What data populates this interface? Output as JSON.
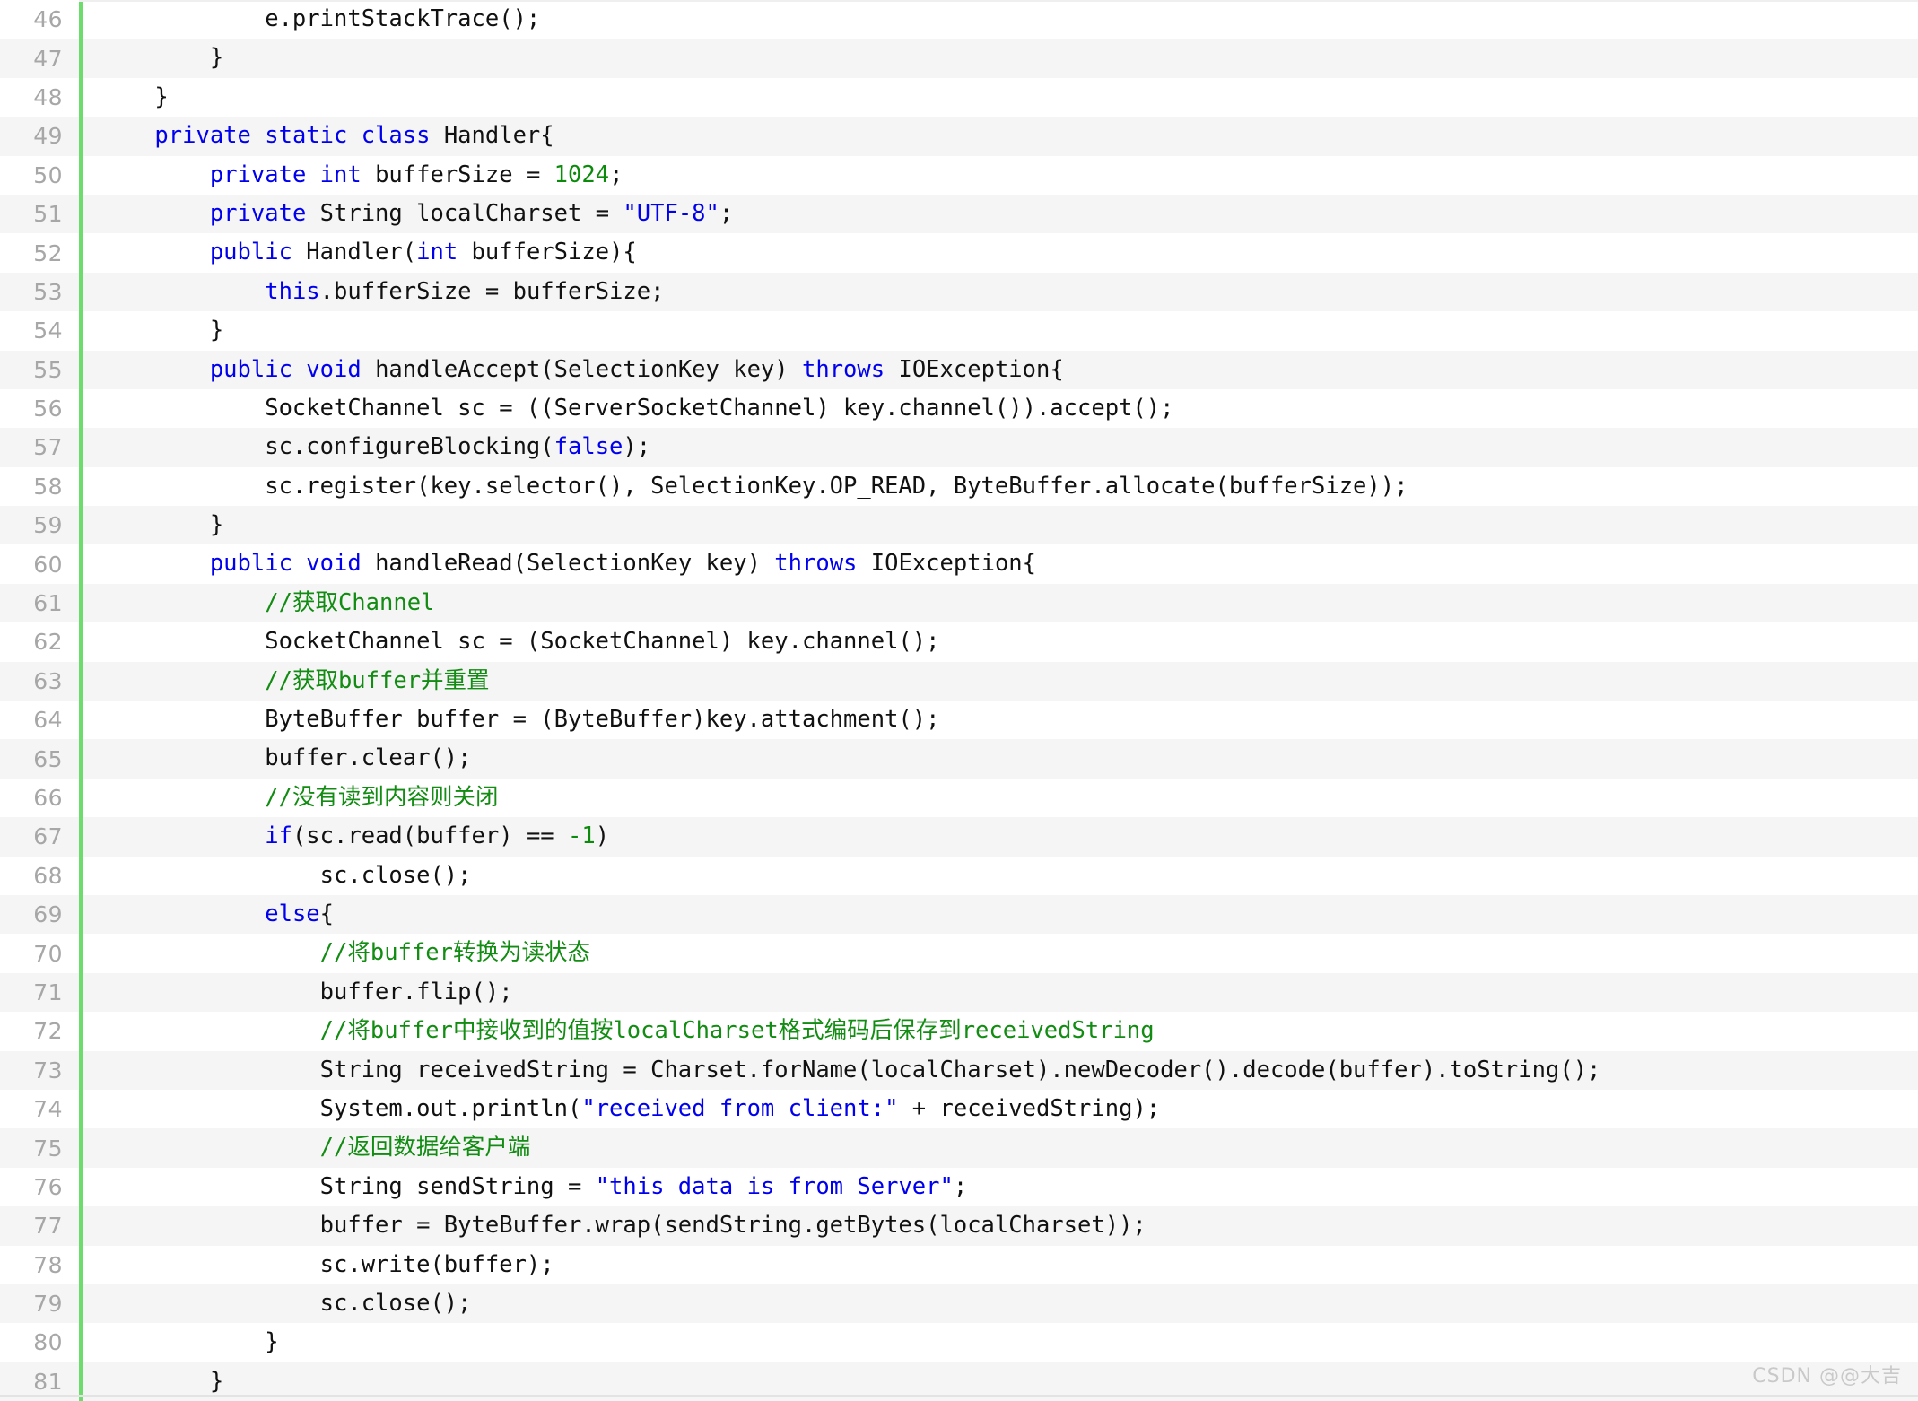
{
  "editor": {
    "language": "java",
    "first_line_number": 46,
    "last_line_number": 81,
    "gutter_accent_color": "#6ddc6d",
    "stripe_color": "#f5f5f5",
    "background_color": "#ffffff",
    "line_number_color": "#a7a7a7",
    "syntax_colors": {
      "keyword": "#0000ee",
      "string": "#0000ee",
      "number": "#0b8a0b",
      "comment": "#128c12",
      "plain": "#111111"
    }
  },
  "watermark": {
    "text": "CSDN @@大吉"
  },
  "lines": [
    {
      "n": "46",
      "text": "            e.printStackTrace();",
      "tokens": [
        {
          "t": "            e.printStackTrace();",
          "c": "plain"
        }
      ]
    },
    {
      "n": "47",
      "text": "        }",
      "tokens": [
        {
          "t": "        }",
          "c": "plain"
        }
      ]
    },
    {
      "n": "48",
      "text": "    }",
      "tokens": [
        {
          "t": "    }",
          "c": "plain"
        }
      ]
    },
    {
      "n": "49",
      "text": "    private static class Handler{",
      "tokens": [
        {
          "t": "    ",
          "c": "plain"
        },
        {
          "t": "private static class",
          "c": "keyword"
        },
        {
          "t": " Handler{",
          "c": "plain"
        }
      ]
    },
    {
      "n": "50",
      "text": "        private int bufferSize = 1024;",
      "tokens": [
        {
          "t": "        ",
          "c": "plain"
        },
        {
          "t": "private int",
          "c": "keyword"
        },
        {
          "t": " bufferSize = ",
          "c": "plain"
        },
        {
          "t": "1024",
          "c": "number"
        },
        {
          "t": ";",
          "c": "plain"
        }
      ]
    },
    {
      "n": "51",
      "text": "        private String localCharset = \"UTF-8\";",
      "tokens": [
        {
          "t": "        ",
          "c": "plain"
        },
        {
          "t": "private",
          "c": "keyword"
        },
        {
          "t": " String localCharset = ",
          "c": "plain"
        },
        {
          "t": "\"UTF-8\"",
          "c": "string"
        },
        {
          "t": ";",
          "c": "plain"
        }
      ]
    },
    {
      "n": "52",
      "text": "        public Handler(int bufferSize){",
      "tokens": [
        {
          "t": "        ",
          "c": "plain"
        },
        {
          "t": "public",
          "c": "keyword"
        },
        {
          "t": " Handler(",
          "c": "plain"
        },
        {
          "t": "int",
          "c": "keyword"
        },
        {
          "t": " bufferSize){",
          "c": "plain"
        }
      ]
    },
    {
      "n": "53",
      "text": "            this.bufferSize = bufferSize;",
      "tokens": [
        {
          "t": "            ",
          "c": "plain"
        },
        {
          "t": "this",
          "c": "keyword"
        },
        {
          "t": ".bufferSize = bufferSize;",
          "c": "plain"
        }
      ]
    },
    {
      "n": "54",
      "text": "        }",
      "tokens": [
        {
          "t": "        }",
          "c": "plain"
        }
      ]
    },
    {
      "n": "55",
      "text": "        public void handleAccept(SelectionKey key) throws IOException{",
      "tokens": [
        {
          "t": "        ",
          "c": "plain"
        },
        {
          "t": "public void",
          "c": "keyword"
        },
        {
          "t": " handleAccept(SelectionKey key) ",
          "c": "plain"
        },
        {
          "t": "throws",
          "c": "keyword"
        },
        {
          "t": " IOException{",
          "c": "plain"
        }
      ]
    },
    {
      "n": "56",
      "text": "            SocketChannel sc = ((ServerSocketChannel) key.channel()).accept();",
      "tokens": [
        {
          "t": "            SocketChannel sc = ((ServerSocketChannel) key.channel()).accept();",
          "c": "plain"
        }
      ]
    },
    {
      "n": "57",
      "text": "            sc.configureBlocking(false);",
      "tokens": [
        {
          "t": "            sc.configureBlocking(",
          "c": "plain"
        },
        {
          "t": "false",
          "c": "keyword"
        },
        {
          "t": ");",
          "c": "plain"
        }
      ]
    },
    {
      "n": "58",
      "text": "            sc.register(key.selector(), SelectionKey.OP_READ, ByteBuffer.allocate(bufferSize));",
      "tokens": [
        {
          "t": "            sc.register(key.selector(), SelectionKey.OP_READ, ByteBuffer.allocate(bufferSize));",
          "c": "plain"
        }
      ]
    },
    {
      "n": "59",
      "text": "        }",
      "tokens": [
        {
          "t": "        }",
          "c": "plain"
        }
      ]
    },
    {
      "n": "60",
      "text": "        public void handleRead(SelectionKey key) throws IOException{",
      "tokens": [
        {
          "t": "        ",
          "c": "plain"
        },
        {
          "t": "public void",
          "c": "keyword"
        },
        {
          "t": " handleRead(SelectionKey key) ",
          "c": "plain"
        },
        {
          "t": "throws",
          "c": "keyword"
        },
        {
          "t": " IOException{",
          "c": "plain"
        }
      ]
    },
    {
      "n": "61",
      "text": "            //获取Channel",
      "tokens": [
        {
          "t": "            ",
          "c": "plain"
        },
        {
          "t": "//获取Channel",
          "c": "comment"
        }
      ]
    },
    {
      "n": "62",
      "text": "            SocketChannel sc = (SocketChannel) key.channel();",
      "tokens": [
        {
          "t": "            SocketChannel sc = (SocketChannel) key.channel();",
          "c": "plain"
        }
      ]
    },
    {
      "n": "63",
      "text": "            //获取buffer并重置",
      "tokens": [
        {
          "t": "            ",
          "c": "plain"
        },
        {
          "t": "//获取buffer并重置",
          "c": "comment"
        }
      ]
    },
    {
      "n": "64",
      "text": "            ByteBuffer buffer = (ByteBuffer)key.attachment();",
      "tokens": [
        {
          "t": "            ByteBuffer buffer = (ByteBuffer)key.attachment();",
          "c": "plain"
        }
      ]
    },
    {
      "n": "65",
      "text": "            buffer.clear();",
      "tokens": [
        {
          "t": "            buffer.clear();",
          "c": "plain"
        }
      ]
    },
    {
      "n": "66",
      "text": "            //没有读到内容则关闭",
      "tokens": [
        {
          "t": "            ",
          "c": "plain"
        },
        {
          "t": "//没有读到内容则关闭",
          "c": "comment"
        }
      ]
    },
    {
      "n": "67",
      "text": "            if(sc.read(buffer) == -1)",
      "tokens": [
        {
          "t": "            ",
          "c": "plain"
        },
        {
          "t": "if",
          "c": "keyword"
        },
        {
          "t": "(sc.read(buffer) == ",
          "c": "plain"
        },
        {
          "t": "-1",
          "c": "number"
        },
        {
          "t": ")",
          "c": "plain"
        }
      ]
    },
    {
      "n": "68",
      "text": "                sc.close();",
      "tokens": [
        {
          "t": "                sc.close();",
          "c": "plain"
        }
      ]
    },
    {
      "n": "69",
      "text": "            else{",
      "tokens": [
        {
          "t": "            ",
          "c": "plain"
        },
        {
          "t": "else",
          "c": "keyword"
        },
        {
          "t": "{",
          "c": "plain"
        }
      ]
    },
    {
      "n": "70",
      "text": "                //将buffer转换为读状态",
      "tokens": [
        {
          "t": "                ",
          "c": "plain"
        },
        {
          "t": "//将buffer转换为读状态",
          "c": "comment"
        }
      ]
    },
    {
      "n": "71",
      "text": "                buffer.flip();",
      "tokens": [
        {
          "t": "                buffer.flip();",
          "c": "plain"
        }
      ]
    },
    {
      "n": "72",
      "text": "                //将buffer中接收到的值按localCharset格式编码后保存到receivedString",
      "tokens": [
        {
          "t": "                ",
          "c": "plain"
        },
        {
          "t": "//将buffer中接收到的值按localCharset格式编码后保存到receivedString",
          "c": "comment"
        }
      ]
    },
    {
      "n": "73",
      "text": "                String receivedString = Charset.forName(localCharset).newDecoder().decode(buffer).toString();",
      "tokens": [
        {
          "t": "                String receivedString = Charset.forName(localCharset).newDecoder().decode(buffer).toString();",
          "c": "plain"
        }
      ]
    },
    {
      "n": "74",
      "text": "                System.out.println(\"received from client:\" + receivedString);",
      "tokens": [
        {
          "t": "                System.out.println(",
          "c": "plain"
        },
        {
          "t": "\"received from client:\"",
          "c": "string"
        },
        {
          "t": " + receivedString);",
          "c": "plain"
        }
      ]
    },
    {
      "n": "75",
      "text": "                //返回数据给客户端",
      "tokens": [
        {
          "t": "                ",
          "c": "plain"
        },
        {
          "t": "//返回数据给客户端",
          "c": "comment"
        }
      ]
    },
    {
      "n": "76",
      "text": "                String sendString = \"this data is from Server\";",
      "tokens": [
        {
          "t": "                String sendString = ",
          "c": "plain"
        },
        {
          "t": "\"this data is from Server\"",
          "c": "string"
        },
        {
          "t": ";",
          "c": "plain"
        }
      ]
    },
    {
      "n": "77",
      "text": "                buffer = ByteBuffer.wrap(sendString.getBytes(localCharset));",
      "tokens": [
        {
          "t": "                buffer = ByteBuffer.wrap(sendString.getBytes(localCharset));",
          "c": "plain"
        }
      ]
    },
    {
      "n": "78",
      "text": "                sc.write(buffer);",
      "tokens": [
        {
          "t": "                sc.write(buffer);",
          "c": "plain"
        }
      ]
    },
    {
      "n": "79",
      "text": "                sc.close();",
      "tokens": [
        {
          "t": "                sc.close();",
          "c": "plain"
        }
      ]
    },
    {
      "n": "80",
      "text": "            }",
      "tokens": [
        {
          "t": "            }",
          "c": "plain"
        }
      ]
    },
    {
      "n": "81",
      "text": "        }",
      "tokens": [
        {
          "t": "        }",
          "c": "plain"
        }
      ]
    }
  ]
}
